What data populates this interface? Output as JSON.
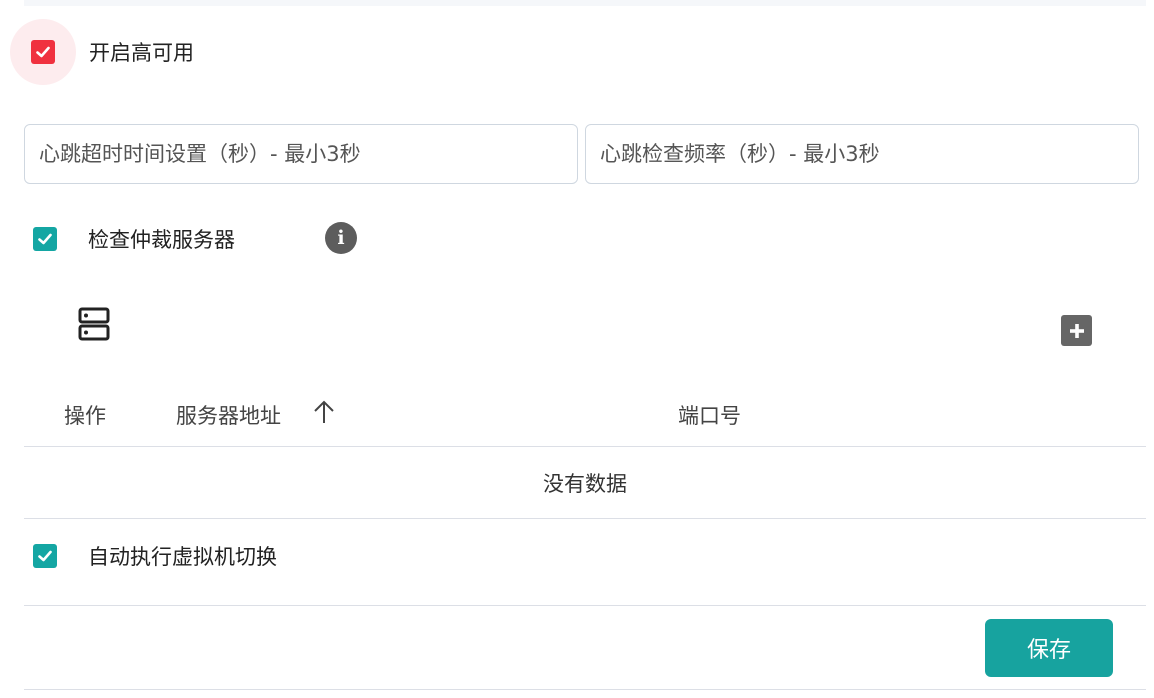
{
  "high_availability": {
    "label": "开启高可用",
    "checked": true
  },
  "inputs": {
    "heartbeat_timeout_placeholder": "心跳超时时间设置（秒）- 最小3秒",
    "heartbeat_frequency_placeholder": "心跳检查频率（秒）- 最小3秒"
  },
  "arbiter": {
    "label": "检查仲裁服务器",
    "checked": true,
    "info_icon": "i"
  },
  "table": {
    "columns": [
      "操作",
      "服务器地址",
      "端口号"
    ],
    "sort_column": "服务器地址",
    "sort_direction": "asc",
    "empty_text": "没有数据",
    "rows": []
  },
  "auto_switch": {
    "label": "自动执行虚拟机切换",
    "checked": true
  },
  "save_label": "保存",
  "colors": {
    "accent_teal": "#17a39f",
    "check_red": "#f0313f"
  },
  "icons": [
    "check-icon",
    "info-icon",
    "server-icon",
    "plus-icon",
    "sort-asc-icon"
  ]
}
